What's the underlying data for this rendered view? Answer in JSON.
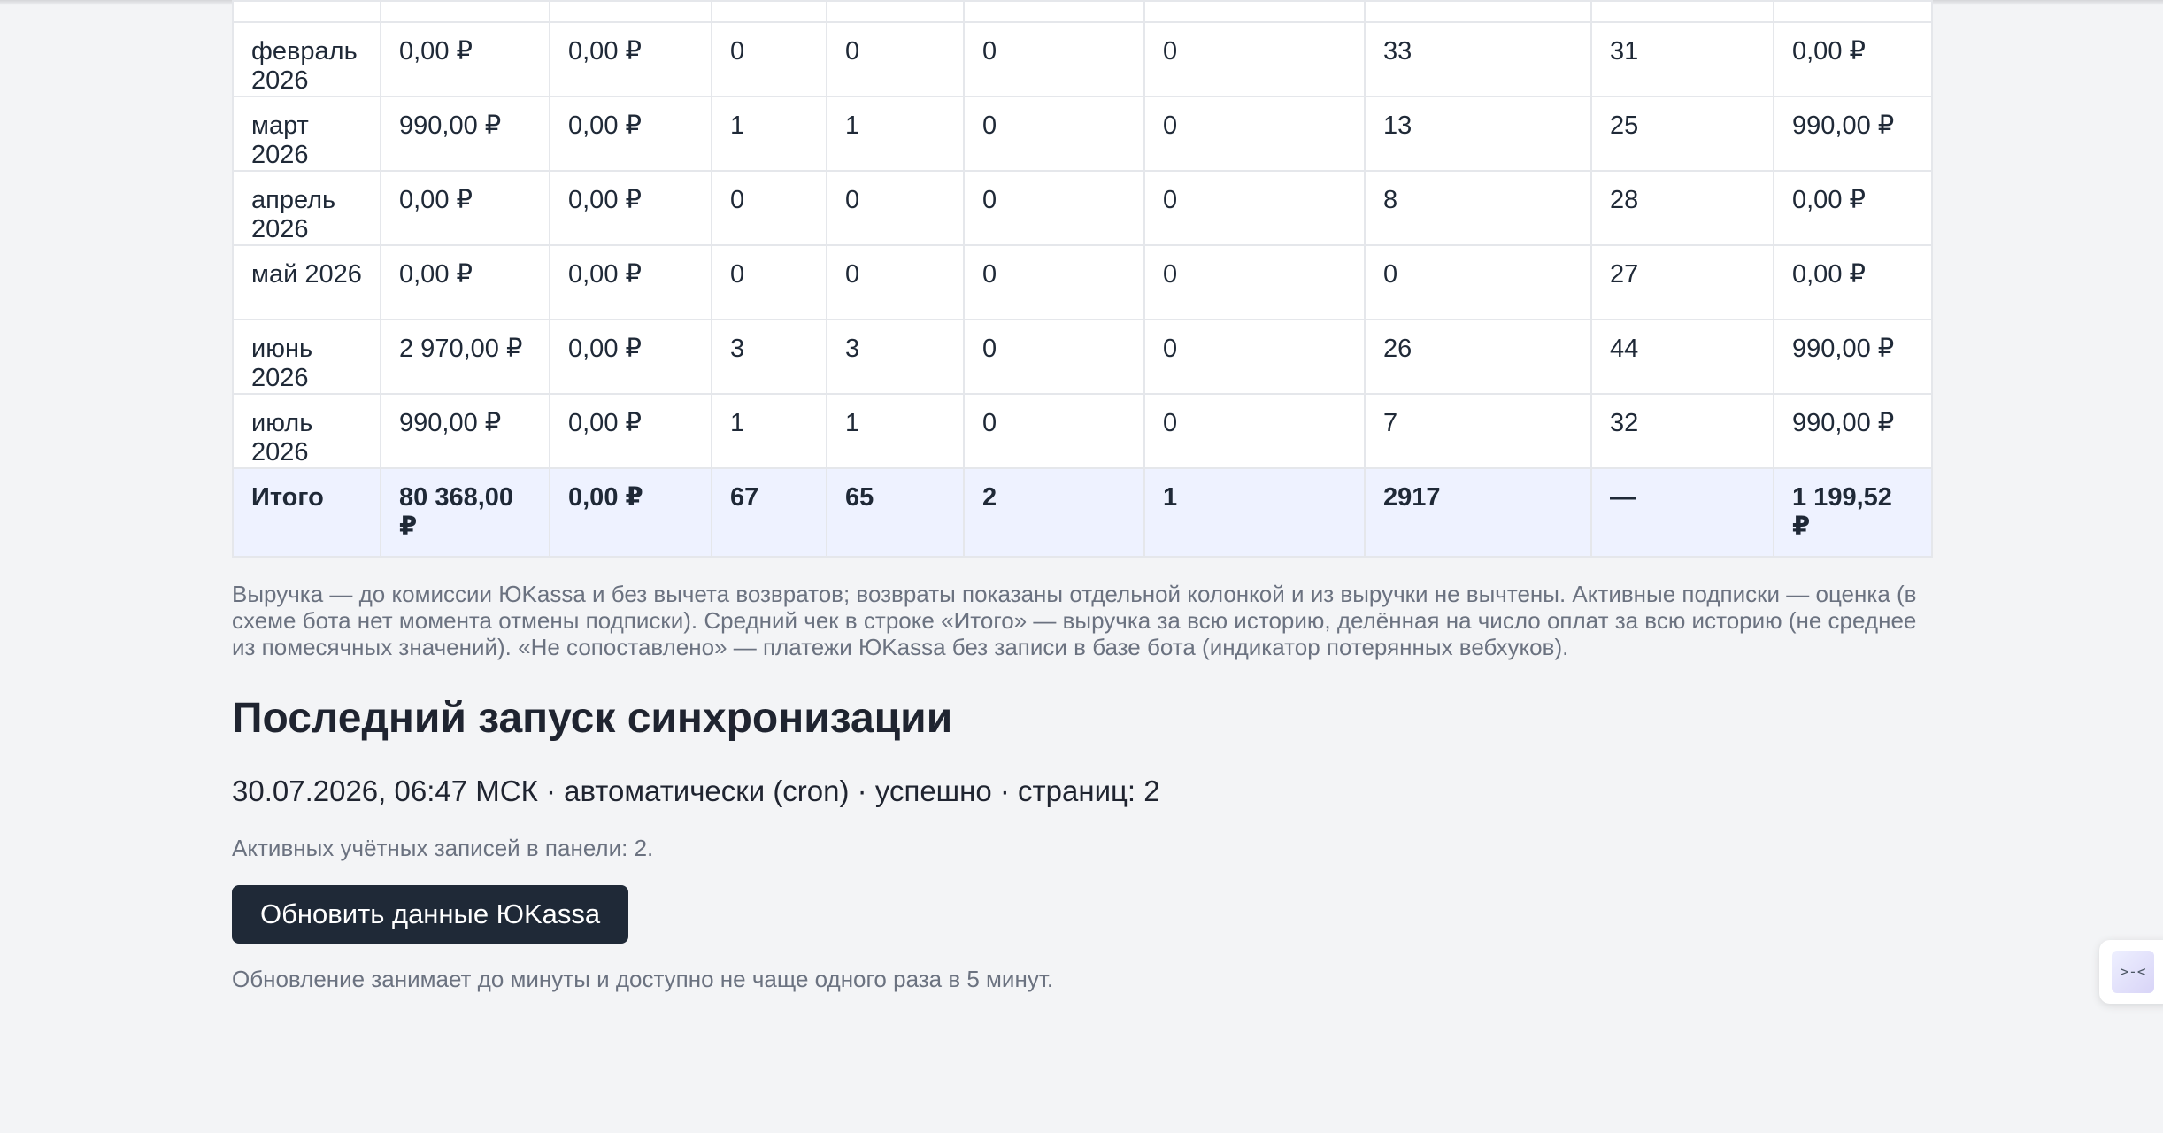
{
  "table": {
    "rows": [
      [
        "",
        "",
        "",
        "",
        "",
        "",
        "",
        "",
        "",
        ""
      ],
      [
        "февраль 2026",
        "0,00 ₽",
        "0,00 ₽",
        "0",
        "0",
        "0",
        "0",
        "33",
        "31",
        "0,00 ₽"
      ],
      [
        "март 2026",
        "990,00 ₽",
        "0,00 ₽",
        "1",
        "1",
        "0",
        "0",
        "13",
        "25",
        "990,00 ₽"
      ],
      [
        "апрель 2026",
        "0,00 ₽",
        "0,00 ₽",
        "0",
        "0",
        "0",
        "0",
        "8",
        "28",
        "0,00 ₽"
      ],
      [
        "май 2026",
        "0,00 ₽",
        "0,00 ₽",
        "0",
        "0",
        "0",
        "0",
        "0",
        "27",
        "0,00 ₽"
      ],
      [
        "июнь 2026",
        "2 970,00 ₽",
        "0,00 ₽",
        "3",
        "3",
        "0",
        "0",
        "26",
        "44",
        "990,00 ₽"
      ],
      [
        "июль 2026",
        "990,00 ₽",
        "0,00 ₽",
        "1",
        "1",
        "0",
        "0",
        "7",
        "32",
        "990,00 ₽"
      ]
    ],
    "total": [
      "Итого",
      "80 368,00 ₽",
      "0,00 ₽",
      "67",
      "65",
      "2",
      "1",
      "2917",
      "—",
      "1 199,52 ₽"
    ]
  },
  "note": "Выручка — до комиссии ЮKassa и без вычета возвратов; возвраты показаны отдельной колонкой и из выручки не вычтены. Активные подписки — оценка (в схеме бота нет момента отмены подписки). Средний чек в строке «Итого» — выручка за всю историю, делённая на число оплат за всю историю (не среднее из помесячных значений). «Не сопоставлено» — платежи ЮKassa без записи в базе бота (индикатор потерянных вебхуков).",
  "sync": {
    "title": "Последний запуск синхронизации",
    "status_line": "30.07.2026, 06:47 МСК · автоматически (cron) · успешно · страниц: 2",
    "accounts": "Активных учётных записей в панели: 2.",
    "button_label": "Обновить данные ЮKassa",
    "hint": "Обновление занимает до минуты и доступно не чаще одного раза в 5 минут."
  },
  "widget": {
    "icon": "assistant-icon",
    "glyph": ">-<"
  }
}
